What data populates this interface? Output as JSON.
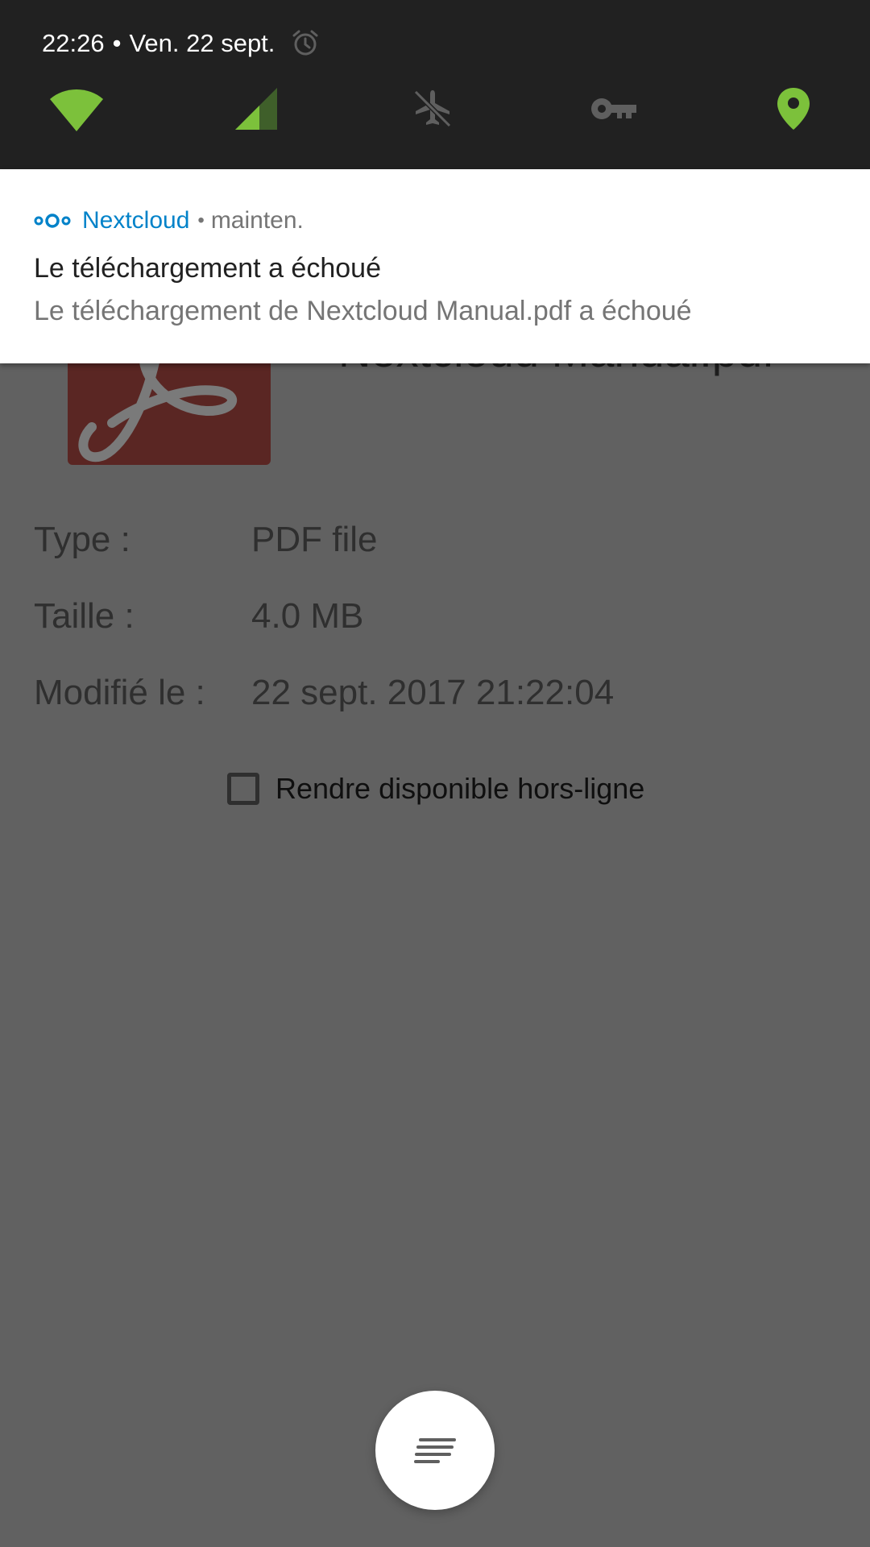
{
  "status": {
    "time": "22:26",
    "separator": "•",
    "date": "Ven. 22 sept.",
    "alarm_icon": "alarm-clock-icon"
  },
  "quick_settings": [
    {
      "name": "wifi",
      "icon": "wifi-icon",
      "active": true
    },
    {
      "name": "mobile-data",
      "icon": "cell-signal-icon",
      "active": true
    },
    {
      "name": "airplane-mode",
      "icon": "airplane-off-icon",
      "active": false
    },
    {
      "name": "vpn",
      "icon": "key-icon",
      "active": false
    },
    {
      "name": "location",
      "icon": "location-pin-icon",
      "active": true
    }
  ],
  "notification": {
    "app_icon": "nextcloud-logo-icon",
    "app_name": "Nextcloud",
    "separator": "•",
    "time": "mainten.",
    "title": "Le téléchargement a échoué",
    "text": "Le téléchargement de Nextcloud Manual.pdf a échoué"
  },
  "file": {
    "icon": "pdf-file-icon",
    "name": "Nextcloud Manual.pdf",
    "details": [
      {
        "label": "Type :",
        "value": "PDF file"
      },
      {
        "label": "Taille :",
        "value": "4.0 MB"
      },
      {
        "label": "Modifié le :",
        "value": "22 sept. 2017 21:22:04"
      }
    ],
    "offline_label": "Rendre disponible hors-ligne",
    "offline_checked": false
  },
  "colors": {
    "shade_bg": "#212121",
    "accent_green": "#7cc13b",
    "nextcloud_blue": "#0082c9",
    "scrim": "#616161"
  },
  "expand_button_icon": "notes-lines-icon"
}
